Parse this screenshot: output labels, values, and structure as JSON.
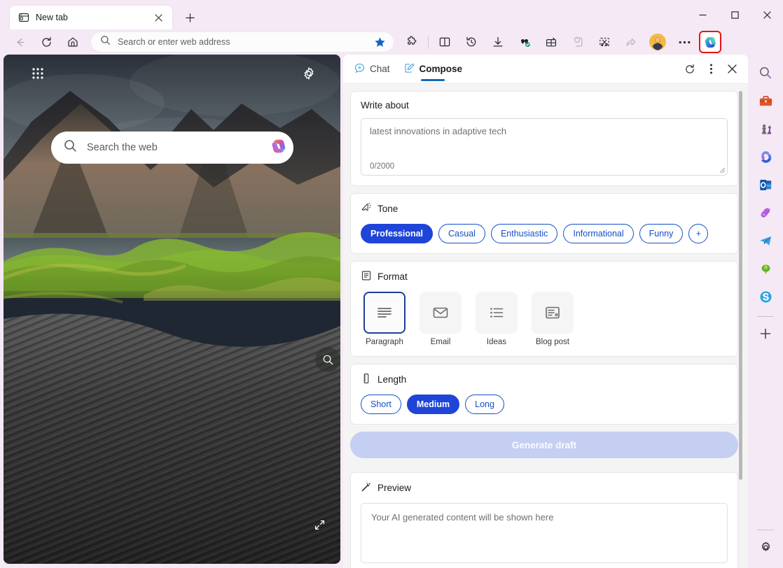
{
  "browser": {
    "tab": {
      "title": "New tab",
      "favicon_icon": "newtab-icon",
      "close_icon": "close-icon"
    },
    "new_tab_button_icon": "plus-icon",
    "window_controls": {
      "minimize_icon": "minimize-icon",
      "maximize_icon": "maximize-icon",
      "close_icon": "close-icon"
    },
    "toolbar": {
      "back_icon": "back-arrow-icon",
      "refresh_icon": "refresh-icon",
      "home_icon": "home-icon",
      "address_placeholder": "Search or enter web address",
      "address_value": "",
      "search_icon": "search-icon",
      "favorite_icon": "star-filled-icon",
      "items": [
        {
          "name": "extensions-icon",
          "label": "Extensions"
        },
        {
          "name": "split-screen-icon",
          "label": "Split screen"
        },
        {
          "name": "history-icon",
          "label": "History"
        },
        {
          "name": "downloads-icon",
          "label": "Downloads"
        },
        {
          "name": "shopping-icon",
          "label": "Shopping"
        },
        {
          "name": "browser-essentials-icon",
          "label": "Browser essentials"
        },
        {
          "name": "collections-icon",
          "label": "Collections"
        },
        {
          "name": "screenshot-icon",
          "label": "Screenshot"
        },
        {
          "name": "share-icon",
          "label": "Share"
        }
      ],
      "profile_icon": "avatar-icon",
      "settings_more_icon": "ellipsis-icon",
      "copilot_icon": "copilot-icon",
      "copilot_highlight_color": "#e81515"
    }
  },
  "new_tab_page": {
    "app_launcher_icon": "grid-apps-icon",
    "page_settings_icon": "gear-icon",
    "search": {
      "placeholder": "Search the web",
      "search_icon": "search-icon",
      "copilot_icon": "copilot-icon"
    },
    "image_magnifier_icon": "magnifier-icon",
    "expand_icon": "expand-arrows-icon"
  },
  "copilot_panel": {
    "tabs": [
      {
        "label": "Chat",
        "icon": "chat-bubble-icon",
        "active": false
      },
      {
        "label": "Compose",
        "icon": "compose-pencil-icon",
        "active": true
      }
    ],
    "header_actions": [
      {
        "name": "refresh-icon",
        "label": "Refresh"
      },
      {
        "name": "more-options-icon",
        "label": "More options"
      },
      {
        "name": "close-icon",
        "label": "Close"
      }
    ],
    "write_about": {
      "label": "Write about",
      "placeholder": "latest innovations in adaptive tech",
      "value": "",
      "counter": "0/2000"
    },
    "tone": {
      "title": "Tone",
      "icon": "megaphone-icon",
      "options": [
        {
          "label": "Professional",
          "selected": true
        },
        {
          "label": "Casual",
          "selected": false
        },
        {
          "label": "Enthusiastic",
          "selected": false
        },
        {
          "label": "Informational",
          "selected": false
        },
        {
          "label": "Funny",
          "selected": false
        }
      ],
      "add_label": "+"
    },
    "format": {
      "title": "Format",
      "icon": "format-document-icon",
      "options": [
        {
          "label": "Paragraph",
          "icon": "paragraph-lines-icon",
          "selected": true
        },
        {
          "label": "Email",
          "icon": "envelope-icon",
          "selected": false
        },
        {
          "label": "Ideas",
          "icon": "bullet-list-icon",
          "selected": false
        },
        {
          "label": "Blog post",
          "icon": "blog-post-icon",
          "selected": false
        }
      ]
    },
    "length": {
      "title": "Length",
      "icon": "ruler-icon",
      "options": [
        {
          "label": "Short",
          "selected": false
        },
        {
          "label": "Medium",
          "selected": true
        },
        {
          "label": "Long",
          "selected": false
        }
      ]
    },
    "generate": {
      "label": "Generate draft",
      "disabled": true
    },
    "preview": {
      "title": "Preview",
      "icon": "magic-wand-icon",
      "placeholder": "Your AI generated content will be shown here"
    },
    "accent_color": "#1f45d8",
    "tab_underline_color": "#0f6cbd"
  },
  "edge_sidebar": {
    "items": [
      {
        "name": "search-icon",
        "label": "Search",
        "glyph": "🔍"
      },
      {
        "name": "tools-icon",
        "label": "Tools",
        "glyph": "🧰"
      },
      {
        "name": "games-icon",
        "label": "Games",
        "glyph": "♟"
      },
      {
        "name": "microsoft365-icon",
        "label": "Microsoft 365",
        "glyph": "⬤"
      },
      {
        "name": "outlook-icon",
        "label": "Outlook",
        "glyph": "⬤"
      },
      {
        "name": "image-creator-icon",
        "label": "Image Creator",
        "glyph": "⬤"
      },
      {
        "name": "telegram-icon",
        "label": "Telegram",
        "glyph": "✈"
      },
      {
        "name": "dropbox-icon",
        "label": "Drop",
        "glyph": "⬤"
      },
      {
        "name": "skype-icon",
        "label": "Skype",
        "glyph": "S"
      }
    ],
    "add_button_icon": "plus-icon",
    "settings_icon": "gear-icon"
  }
}
